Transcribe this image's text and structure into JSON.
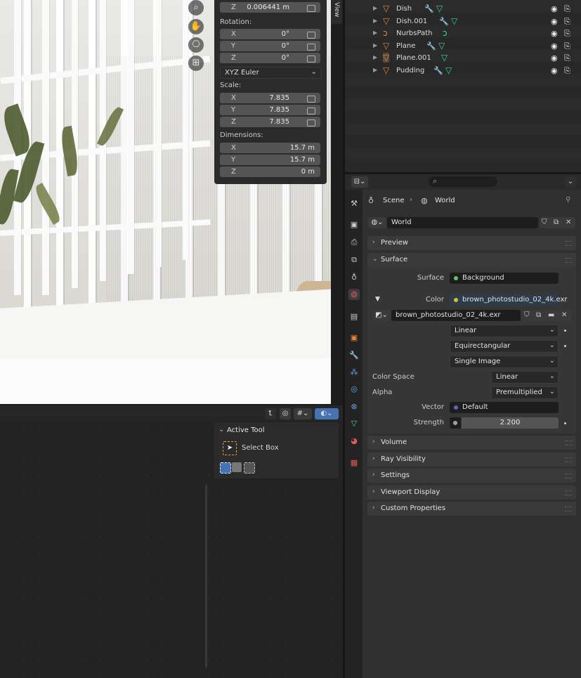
{
  "npanel": {
    "location_z": "0.006441 m",
    "rotation_label": "Rotation:",
    "rotation": [
      {
        "axis": "X",
        "value": "0°"
      },
      {
        "axis": "Y",
        "value": "0°"
      },
      {
        "axis": "Z",
        "value": "0°"
      }
    ],
    "rotation_mode": "XYZ Euler",
    "scale_label": "Scale:",
    "scale": [
      {
        "axis": "X",
        "value": "7.835"
      },
      {
        "axis": "Y",
        "value": "7.835"
      },
      {
        "axis": "Z",
        "value": "7.835"
      }
    ],
    "dimensions_label": "Dimensions:",
    "dimensions": [
      {
        "axis": "X",
        "value": "15.7 m"
      },
      {
        "axis": "Y",
        "value": "15.7 m"
      },
      {
        "axis": "Z",
        "value": "0 m"
      }
    ],
    "view_tab": "View"
  },
  "outliner": {
    "items": [
      {
        "name": "Dish"
      },
      {
        "name": "Dish.001"
      },
      {
        "name": "NurbsPath"
      },
      {
        "name": "Plane"
      },
      {
        "name": "Plane.001"
      },
      {
        "name": "Pudding"
      }
    ]
  },
  "active_tool": {
    "title": "Active Tool",
    "tool": "Select Box"
  },
  "properties": {
    "breadcrumb": {
      "scene": "Scene",
      "world": "World"
    },
    "world_name": "World",
    "panels": {
      "preview": "Preview",
      "surface": "Surface",
      "volume": "Volume",
      "ray_visibility": "Ray Visibility",
      "settings": "Settings",
      "viewport_display": "Viewport Display",
      "custom_properties": "Custom Properties"
    },
    "surface": {
      "surface_label": "Surface",
      "surface_value": "Background",
      "color_label": "Color",
      "color_value": "brown_photostudio_02_4k.exr",
      "image_name": "brown_photostudio_02_4k.exr",
      "interpolation": "Linear",
      "projection": "Equirectangular",
      "source": "Single Image",
      "color_space_label": "Color Space",
      "color_space": "Linear",
      "alpha_label": "Alpha",
      "alpha": "Premultiplied",
      "vector_label": "Vector",
      "vector_value": "Default",
      "strength_label": "Strength",
      "strength_value": "2.200"
    }
  },
  "colors": {
    "accent_blue": "#4772b3",
    "object_orange": "#e4863c",
    "mesh_green": "#3fd1a4",
    "modifier_blue": "#6aa2e8",
    "socket_green": "#63c763",
    "socket_yellow": "#c7c729",
    "socket_purple": "#6363c7"
  }
}
